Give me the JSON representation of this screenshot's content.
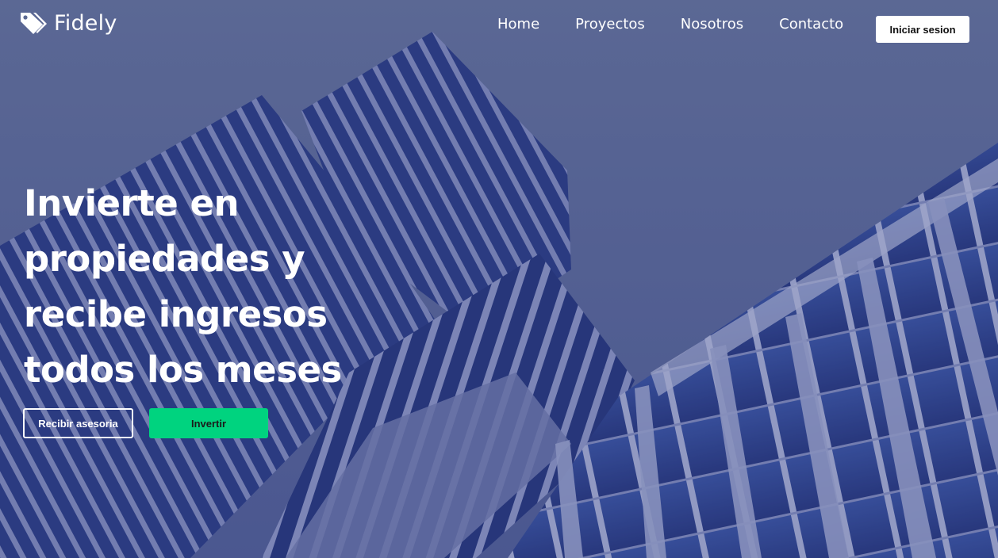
{
  "brand": {
    "name": "Fidely",
    "icon": "tags-icon"
  },
  "nav": {
    "items": [
      {
        "label": "Home"
      },
      {
        "label": "Proyectos"
      },
      {
        "label": "Nosotros"
      },
      {
        "label": "Contacto"
      }
    ],
    "login_label": "Iniciar sesion"
  },
  "hero": {
    "headline": "Invierte en propiedades y recibe ingresos todos los meses",
    "secondary_button": "Recibir asesoria",
    "primary_button": "Invertir",
    "background": "building-photo"
  },
  "colors": {
    "accent": "#00d37f",
    "overlay": "#303878",
    "text": "#ffffff"
  }
}
